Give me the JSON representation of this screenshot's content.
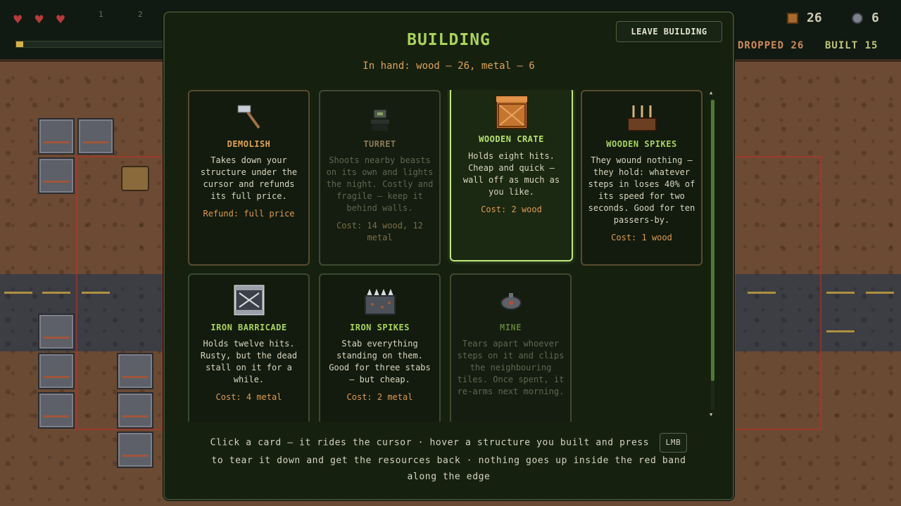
{
  "hud": {
    "hearts": [
      "♥",
      "♥",
      "♥"
    ],
    "slots": [
      "1",
      "2"
    ],
    "day_progress": 0.05,
    "wood_count": "26",
    "metal_count": "6",
    "dropped_label": "DROPPED",
    "dropped_value": "26",
    "built_label": "BUILT",
    "built_value": "15"
  },
  "modal": {
    "title": "BUILDING",
    "leave_button": "LEAVE BUILDING",
    "in_hand": "In hand: wood — 26, metal — 6",
    "hint_line1": "Click a card — it rides the cursor · hover a structure you built and press",
    "hint_key": "LMB",
    "hint_line2": "to tear it down and get the resources back · nothing goes up inside the red band",
    "hint_line3": "along the edge"
  },
  "cards": [
    {
      "name": "DEMOLISH",
      "desc": "Takes down your structure under the cursor and refunds its full price.",
      "cost": "Refund: full price",
      "icon": "hammer-icon",
      "state": "available"
    },
    {
      "name": "TURRET",
      "desc": "Shoots nearby beasts on its own and lights the night. Costly and fragile — keep it behind walls.",
      "cost": "Cost: 14 wood, 12 metal",
      "icon": "turret-icon",
      "state": "locked"
    },
    {
      "name": "WOODEN CRATE",
      "desc": "Holds eight hits. Cheap and quick — wall off as much as you like.",
      "cost": "Cost: 2 wood",
      "icon": "crate-icon",
      "state": "selected"
    },
    {
      "name": "WOODEN SPIKES",
      "desc": "They wound nothing — they hold: whatever steps in loses 40% of its speed for two seconds. Good for ten passers-by.",
      "cost": "Cost: 1 wood",
      "icon": "wooden-spikes-icon",
      "state": "available"
    },
    {
      "name": "IRON BARRICADE",
      "desc": "Holds twelve hits. Rusty, but the dead stall on it for a while.",
      "cost": "Cost: 4 metal",
      "icon": "barricade-icon",
      "state": "available"
    },
    {
      "name": "IRON SPIKES",
      "desc": "Stab everything standing on them. Good for three stabs — but cheap.",
      "cost": "Cost: 2 metal",
      "icon": "iron-spikes-icon",
      "state": "available"
    },
    {
      "name": "MINE",
      "desc": "Tears apart whoever steps on it and clips the neighbouring tiles. Once spent, it re-arms next morning.",
      "cost": "",
      "icon": "mine-icon",
      "state": "locked"
    }
  ],
  "colors": {
    "accent_green": "#a9d35a",
    "accent_orange": "#dda25a",
    "panel_bg": "#16200f",
    "selected_border": "#bde67a"
  }
}
